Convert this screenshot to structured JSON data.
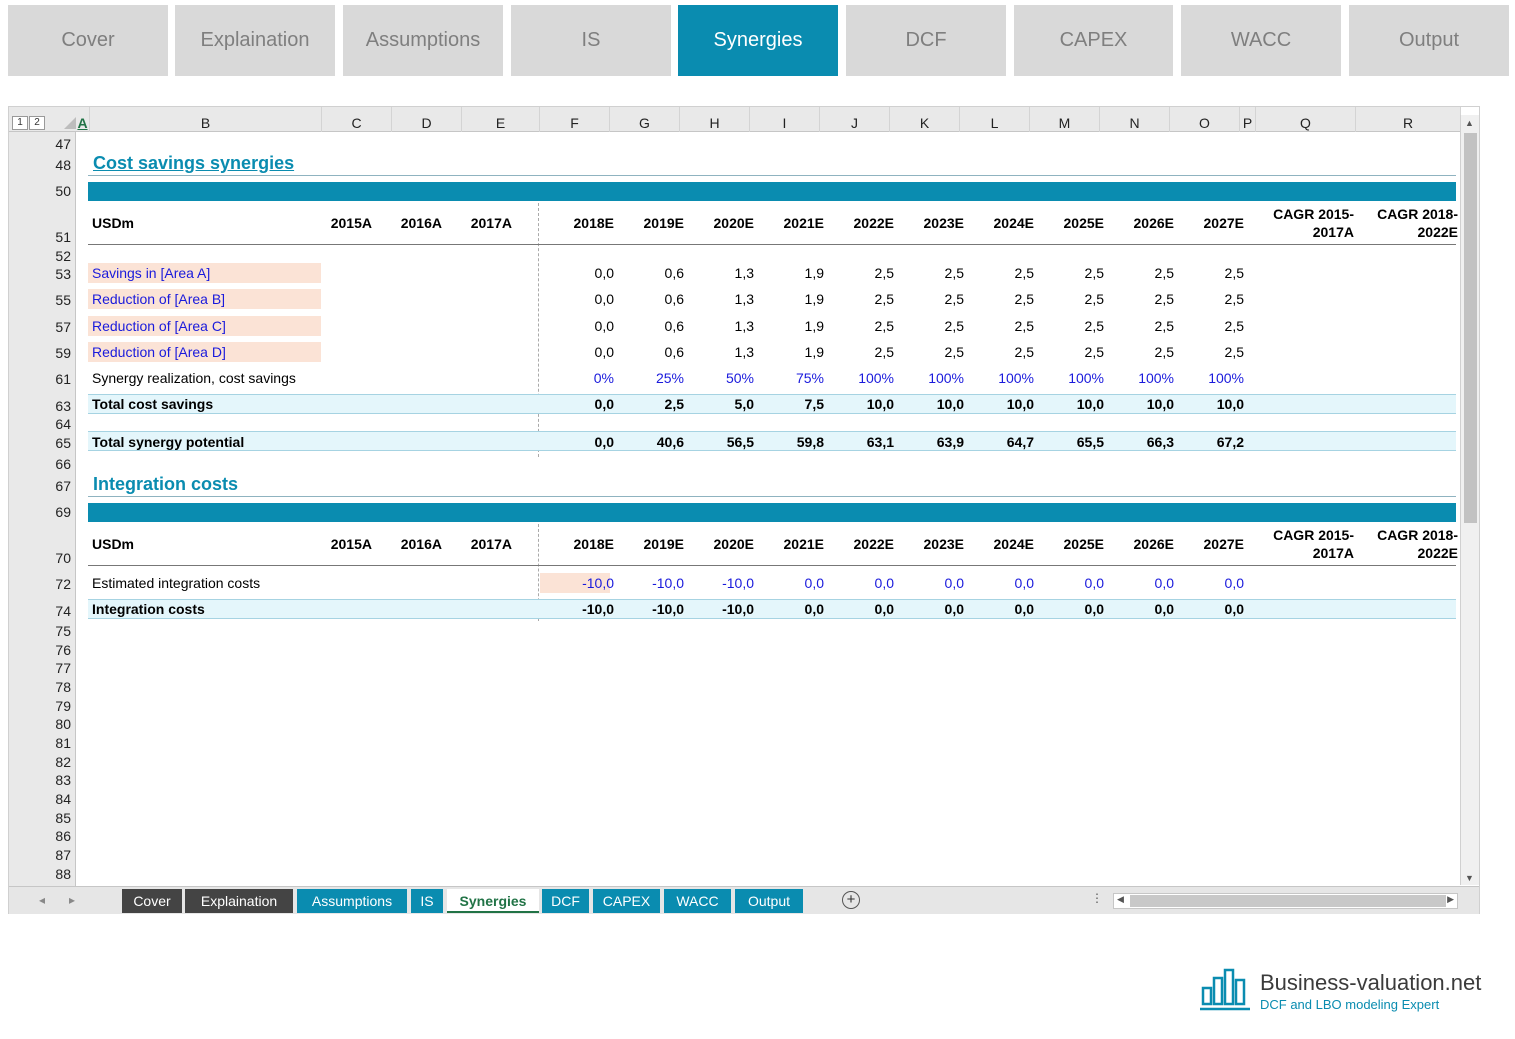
{
  "topnav": [
    {
      "label": "Cover",
      "active": false
    },
    {
      "label": "Explaination",
      "active": false
    },
    {
      "label": "Assumptions",
      "active": false
    },
    {
      "label": "IS",
      "active": false
    },
    {
      "label": "Synergies",
      "active": true
    },
    {
      "label": "DCF",
      "active": false
    },
    {
      "label": "CAPEX",
      "active": false
    },
    {
      "label": "WACC",
      "active": false
    },
    {
      "label": "Output",
      "active": false
    }
  ],
  "outline_levels": [
    "1",
    "2"
  ],
  "columns": [
    "A",
    "B",
    "C",
    "D",
    "E",
    "F",
    "G",
    "H",
    "I",
    "J",
    "K",
    "L",
    "M",
    "N",
    "O",
    "P",
    "Q",
    "R"
  ],
  "row_numbers": [
    "47",
    "48",
    "50",
    "51",
    "52",
    "53",
    "55",
    "57",
    "59",
    "61",
    "63",
    "64",
    "65",
    "66",
    "67",
    "69",
    "70",
    "72",
    "74",
    "75",
    "76",
    "77",
    "78",
    "79",
    "80",
    "81",
    "82",
    "83",
    "84",
    "85",
    "86",
    "87",
    "88"
  ],
  "cost_savings": {
    "title": "Cost savings synergies",
    "header": {
      "unit": "USDm",
      "years": [
        "2015A",
        "2016A",
        "2017A",
        "2018E",
        "2019E",
        "2020E",
        "2021E",
        "2022E",
        "2023E",
        "2024E",
        "2025E",
        "2026E",
        "2027E"
      ],
      "cagr1": [
        "CAGR 2015-",
        "2017A"
      ],
      "cagr2": [
        "CAGR 2018-",
        "2022E"
      ]
    },
    "rows": [
      {
        "label": "Savings in [Area A]",
        "values": [
          "0,0",
          "0,6",
          "1,3",
          "1,9",
          "2,5",
          "2,5",
          "2,5",
          "2,5",
          "2,5",
          "2,5"
        ]
      },
      {
        "label": "Reduction of [Area B]",
        "values": [
          "0,0",
          "0,6",
          "1,3",
          "1,9",
          "2,5",
          "2,5",
          "2,5",
          "2,5",
          "2,5",
          "2,5"
        ]
      },
      {
        "label": "Reduction of [Area C]",
        "values": [
          "0,0",
          "0,6",
          "1,3",
          "1,9",
          "2,5",
          "2,5",
          "2,5",
          "2,5",
          "2,5",
          "2,5"
        ]
      },
      {
        "label": "Reduction of [Area D]",
        "values": [
          "0,0",
          "0,6",
          "1,3",
          "1,9",
          "2,5",
          "2,5",
          "2,5",
          "2,5",
          "2,5",
          "2,5"
        ]
      }
    ],
    "realization": {
      "label": "Synergy realization, cost savings",
      "values": [
        "0%",
        "25%",
        "50%",
        "75%",
        "100%",
        "100%",
        "100%",
        "100%",
        "100%",
        "100%"
      ]
    },
    "total": {
      "label": "Total cost savings",
      "values": [
        "0,0",
        "2,5",
        "5,0",
        "7,5",
        "10,0",
        "10,0",
        "10,0",
        "10,0",
        "10,0",
        "10,0"
      ]
    },
    "potential": {
      "label": "Total synergy potential",
      "values": [
        "0,0",
        "40,6",
        "56,5",
        "59,8",
        "63,1",
        "63,9",
        "64,7",
        "65,5",
        "66,3",
        "67,2"
      ]
    }
  },
  "integration": {
    "title": "Integration costs",
    "estimated": {
      "label": "Estimated integration costs",
      "values": [
        "-10,0",
        "-10,0",
        "-10,0",
        "0,0",
        "0,0",
        "0,0",
        "0,0",
        "0,0",
        "0,0",
        "0,0"
      ]
    },
    "total": {
      "label": "Integration costs",
      "values": [
        "-10,0",
        "-10,0",
        "-10,0",
        "0,0",
        "0,0",
        "0,0",
        "0,0",
        "0,0",
        "0,0",
        "0,0"
      ]
    }
  },
  "sheet_tabs": [
    {
      "label": "Cover",
      "style": "dark"
    },
    {
      "label": "Explaination",
      "style": "dark"
    },
    {
      "label": "Assumptions",
      "style": "teal"
    },
    {
      "label": "IS",
      "style": "teal"
    },
    {
      "label": "Synergies",
      "style": "active"
    },
    {
      "label": "DCF",
      "style": "teal"
    },
    {
      "label": "CAPEX",
      "style": "teal"
    },
    {
      "label": "WACC",
      "style": "teal"
    },
    {
      "label": "Output",
      "style": "teal"
    }
  ],
  "add_sheet": "+",
  "logo": {
    "title": "Business-valuation.net",
    "subtitle": "DCF and LBO modeling Expert"
  },
  "colors": {
    "accent": "#0a8cb0",
    "input_fill": "#fbe3d6",
    "total_fill": "#e4f6fb",
    "input_text": "#1a1adc"
  }
}
